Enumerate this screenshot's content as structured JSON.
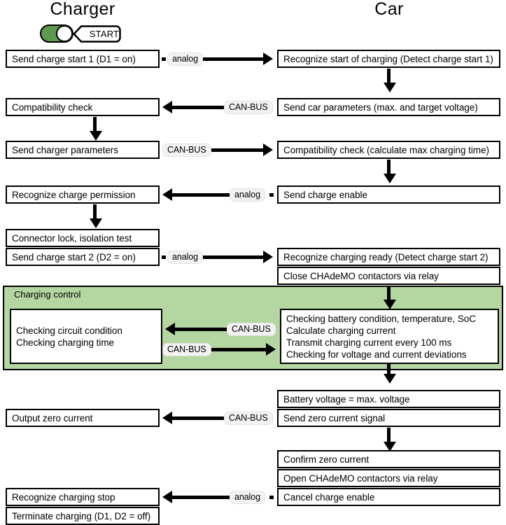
{
  "columns": {
    "charger": "Charger",
    "car": "Car"
  },
  "control": {
    "toggle_state": "on",
    "toggle_color": "#5e9950",
    "start_label": "START"
  },
  "panel": {
    "label": "Charging control",
    "color": "#b4d7a1"
  },
  "connectors": {
    "analog": "analog",
    "canbus": "CAN-BUS"
  },
  "charger_steps": [
    {
      "id": "send-charge-start-1",
      "label": "Send charge start 1 (D1 = on)"
    },
    {
      "id": "compatibility-check",
      "label": "Compatibility check"
    },
    {
      "id": "send-charger-parameters",
      "label": "Send charger parameters"
    },
    {
      "id": "recognize-charge-permission",
      "label": "Recognize charge permission"
    },
    {
      "id": "connector-lock",
      "label": "Connector lock, isolation test"
    },
    {
      "id": "send-charge-start-2",
      "label": "Send charge start 2 (D2 = on)"
    },
    {
      "id": "checking-circuit",
      "label": "Checking circuit condition\nChecking charging time"
    },
    {
      "id": "output-zero-current",
      "label": "Output zero current"
    },
    {
      "id": "recognize-charging-stop",
      "label": "Recognize charging stop"
    },
    {
      "id": "terminate-charging",
      "label": "Terminate charging (D1, D2 = off)"
    }
  ],
  "car_steps": [
    {
      "id": "recognize-start-of-charging",
      "label": "Recognize start of charging (Detect charge start 1)"
    },
    {
      "id": "send-car-parameters",
      "label": "Send car parameters (max. and target voltage)"
    },
    {
      "id": "compatibility-check-car",
      "label": "Compatibility check (calculate max charging time)"
    },
    {
      "id": "send-charge-enable",
      "label": "Send charge enable"
    },
    {
      "id": "recognize-charging-ready",
      "label": "Recognize charging ready (Detect charge start 2)"
    },
    {
      "id": "close-chademo",
      "label": "Close CHAdeMO contactors via relay"
    },
    {
      "id": "checking-battery",
      "label": "Checking battery condition, temperature, SoC\nCalculate charging current\nTransmit charging current every 100 ms\nChecking for voltage and current deviations"
    },
    {
      "id": "battery-voltage-max",
      "label": "Battery voltage = max. voltage"
    },
    {
      "id": "send-zero-current-signal",
      "label": "Send zero current signal"
    },
    {
      "id": "confirm-zero-current",
      "label": "Confirm zero current"
    },
    {
      "id": "open-chademo",
      "label": "Open CHAdeMO contactors via relay"
    },
    {
      "id": "cancel-charge-enable",
      "label": "Cancel charge enable"
    }
  ],
  "cross_links": [
    {
      "id": "link-1",
      "protocol": "analog",
      "direction": "right"
    },
    {
      "id": "link-2",
      "protocol": "CAN-BUS",
      "direction": "left"
    },
    {
      "id": "link-3",
      "protocol": "CAN-BUS",
      "direction": "right"
    },
    {
      "id": "link-4",
      "protocol": "analog",
      "direction": "left"
    },
    {
      "id": "link-5",
      "protocol": "analog",
      "direction": "right"
    },
    {
      "id": "link-6",
      "protocol": "CAN-BUS",
      "direction": "left"
    },
    {
      "id": "link-7",
      "protocol": "CAN-BUS",
      "direction": "right"
    },
    {
      "id": "link-8",
      "protocol": "CAN-BUS",
      "direction": "left"
    },
    {
      "id": "link-9",
      "protocol": "analog",
      "direction": "left"
    }
  ]
}
